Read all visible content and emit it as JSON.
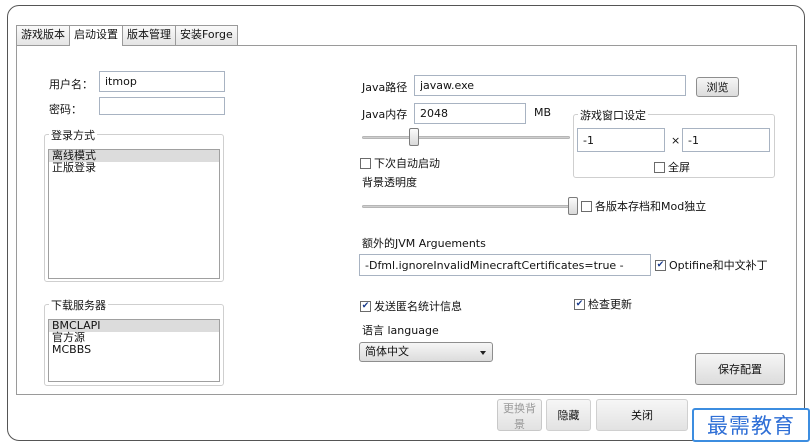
{
  "tabs": [
    "游戏版本",
    "启动设置",
    "版本管理",
    "安装Forge"
  ],
  "login": {
    "username_label": "用户名：",
    "username_value": "itmop",
    "password_label": "密码：",
    "mode_title": "登录方式",
    "modes": [
      "离线模式",
      "正版登录"
    ]
  },
  "download": {
    "title": "下载服务器",
    "servers": [
      "BMCLAPI",
      "官方源",
      "MCBBS"
    ]
  },
  "java": {
    "path_label": "Java路径",
    "path_value": "javaw.exe",
    "browse_label": "浏览",
    "memory_label": "Java内存",
    "memory_value": "2048",
    "memory_unit": "MB",
    "auto_start_label": "下次自动启动"
  },
  "window_settings": {
    "title": "游戏窗口设定",
    "width": "-1",
    "times": "×",
    "height": "-1",
    "fullscreen_label": "全屏"
  },
  "opacity": {
    "label": "背景透明度",
    "independent_label": "各版本存档和Mod独立"
  },
  "jvm": {
    "label": "额外的JVM Arguements",
    "value": "-Dfml.ignoreInvalidMinecraftCertificates=true -",
    "optifine_label": "Optifine和中文补丁"
  },
  "misc": {
    "stats_label": "发送匿名统计信息",
    "update_label": "检查更新",
    "language_label": "语言 language",
    "language_value": "简体中文",
    "save_label": "保存配置"
  },
  "footer": {
    "change_bg": "更换背景",
    "hide": "隐藏",
    "close": "关闭"
  },
  "watermark": "最需教育"
}
